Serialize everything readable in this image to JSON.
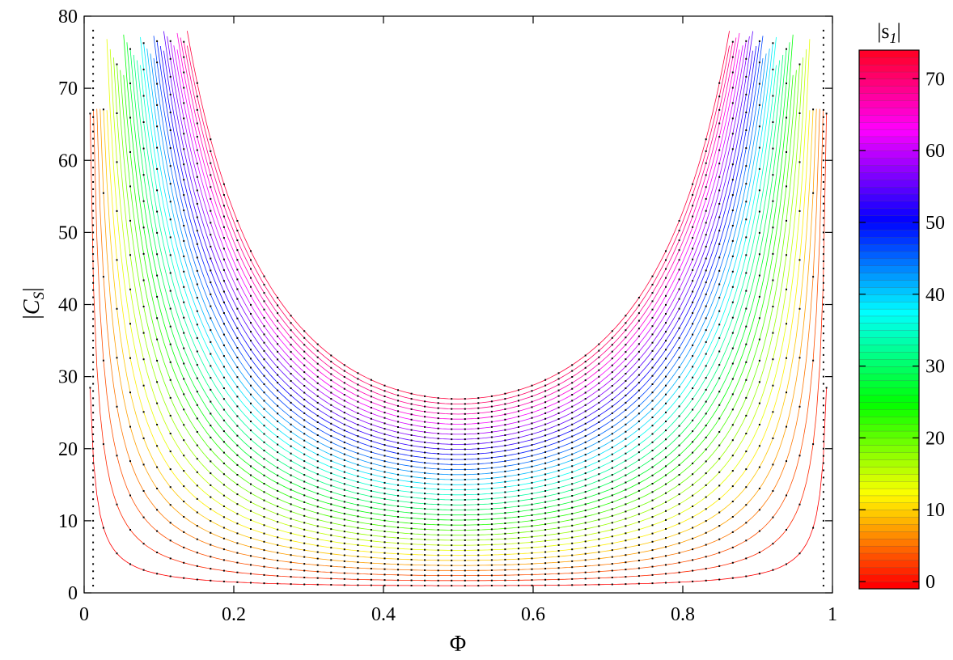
{
  "chart_data": {
    "type": "line",
    "title": "",
    "xlabel": "Φ",
    "ylabel": "|C_S|",
    "xlim": [
      0,
      1
    ],
    "ylim": [
      0,
      80
    ],
    "xticks": [
      "0",
      "0.2",
      "0.4",
      "0.6",
      "0.8",
      "1"
    ],
    "yticks": [
      "0",
      "10",
      "20",
      "30",
      "40",
      "50",
      "60",
      "70",
      "80"
    ],
    "grid": false,
    "curve_family": {
      "description": "one curve per value of |s1|; each curve satisfies |C_S| = 1 + k/(Phi*(1-Phi)) style rise near the edges",
      "s1_min": 0,
      "s1_max": 74,
      "s1_step": 2
    },
    "colorbar": {
      "title_main": "|s",
      "title_sub": "1",
      "title_end": "|",
      "range": [
        0,
        75
      ],
      "ticks": [
        "0",
        "10",
        "20",
        "30",
        "40",
        "50",
        "60",
        "70"
      ],
      "colormap": "hsv (red → yellow → green → cyan → blue → magenta → red)"
    }
  }
}
